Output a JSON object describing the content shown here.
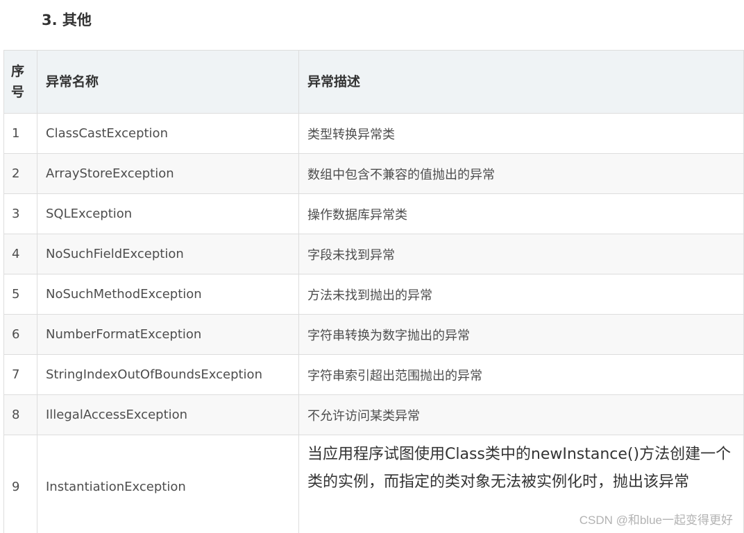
{
  "section": {
    "title": "3. 其他"
  },
  "table": {
    "headers": {
      "no": "序号",
      "name": "异常名称",
      "desc": "异常描述"
    },
    "rows": [
      {
        "no": "1",
        "name": "ClassCastException",
        "desc": "类型转换异常类"
      },
      {
        "no": "2",
        "name": "ArrayStoreException",
        "desc": "数组中包含不兼容的值抛出的异常"
      },
      {
        "no": "3",
        "name": "SQLException",
        "desc": "操作数据库异常类"
      },
      {
        "no": "4",
        "name": "NoSuchFieldException",
        "desc": "字段未找到异常"
      },
      {
        "no": "5",
        "name": "NoSuchMethodException",
        "desc": "方法未找到抛出的异常"
      },
      {
        "no": "6",
        "name": "NumberFormatException",
        "desc": "字符串转换为数字抛出的异常"
      },
      {
        "no": "7",
        "name": "StringIndexOutOfBoundsException",
        "desc": "字符串索引超出范围抛出的异常"
      },
      {
        "no": "8",
        "name": "IllegalAccessException",
        "desc": "不允许访问某类异常"
      },
      {
        "no": "9",
        "name": "InstantiationException",
        "desc": " 当应用程序试图使用Class类中的newInstance()方法创建一个类的实例，而指定的类对象无法被实例化时，抛出该异常"
      }
    ]
  },
  "watermark": {
    "text": "CSDN @和blue一起变得更好"
  }
}
